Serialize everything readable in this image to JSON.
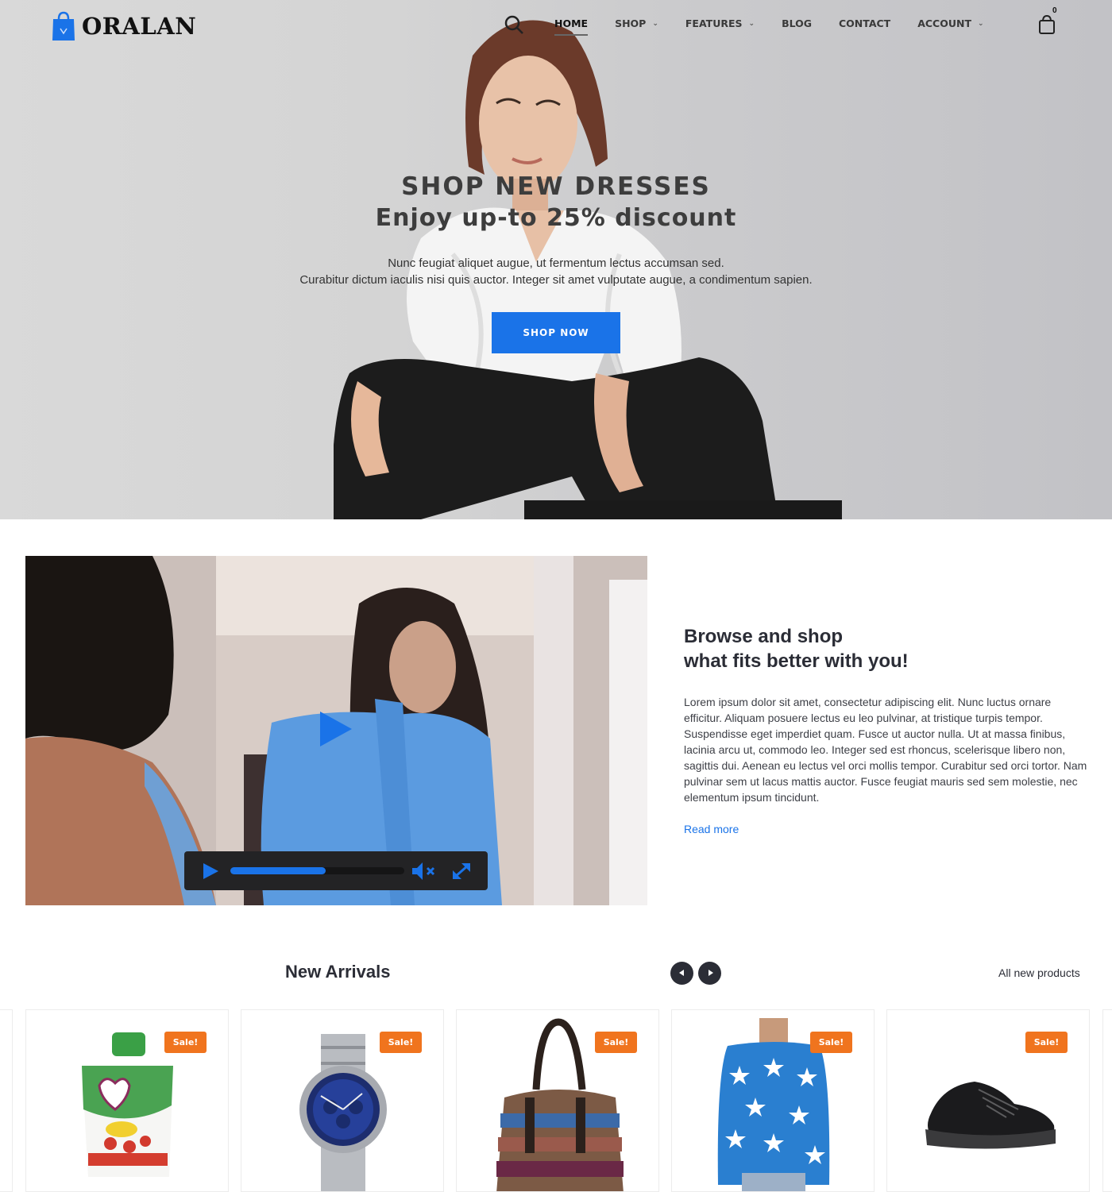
{
  "header": {
    "logo_text": "ORALAN",
    "nav": [
      {
        "label": "HOME",
        "active": true,
        "has_dropdown": false
      },
      {
        "label": "SHOP",
        "active": false,
        "has_dropdown": true
      },
      {
        "label": "FEATURES",
        "active": false,
        "has_dropdown": true
      },
      {
        "label": "BLOG",
        "active": false,
        "has_dropdown": false
      },
      {
        "label": "CONTACT",
        "active": false,
        "has_dropdown": false
      },
      {
        "label": "ACCOUNT",
        "active": false,
        "has_dropdown": true
      }
    ],
    "icons": {
      "search": "search-icon",
      "cart": "shopping-bag-icon"
    },
    "cart_count": "0"
  },
  "hero": {
    "title": "SHOP NEW DRESSES",
    "subtitle": "Enjoy up-to 25% discount",
    "description_line1": "Nunc feugiat aliquet augue, ut fermentum lectus accumsan sed.",
    "description_line2": "Curabitur dictum iaculis nisi quis auctor. Integer sit amet vulputate augue, a condimentum sapien.",
    "cta_label": "SHOP NOW"
  },
  "video": {
    "progress_fraction": 0.55,
    "muted": true,
    "icons": {
      "play": "play-icon",
      "mute": "volume-mute-icon",
      "fullscreen": "fullscreen-icon"
    }
  },
  "about": {
    "title_line1": "Browse and shop",
    "title_line2": "what fits better with you!",
    "text": "Lorem ipsum dolor sit amet, consectetur adipiscing elit. Nunc luctus ornare efficitur. Aliquam posuere lectus eu leo pulvinar, at tristique turpis tempor. Suspendisse eget imperdiet quam. Fusce ut auctor nulla. Ut at massa finibus, lacinia arcu ut, commodo leo. Integer sed est rhoncus, scelerisque libero non, sagittis dui. Aenean eu lectus vel orci mollis tempor. Curabitur sed orci tortor. Nam pulvinar sem ut lacus mattis auctor. Fusce feugiat mauris sed sem molestie, nec elementum ipsum tincidunt.",
    "read_more": "Read more"
  },
  "arrivals": {
    "title": "New Arrivals",
    "all_link": "All new products",
    "products": [
      {
        "image": "baby-food-pouch",
        "badge": "Sale!"
      },
      {
        "image": "wristwatch",
        "badge": "Sale!"
      },
      {
        "image": "striped-handbag",
        "badge": "Sale!"
      },
      {
        "image": "star-sweater",
        "badge": "Sale!"
      },
      {
        "image": "black-sneaker",
        "badge": "Sale!"
      }
    ]
  },
  "colors": {
    "accent": "#1a73e8",
    "sale_badge": "#f0741e",
    "dark_text": "#2b2d36",
    "video_controls_bg": "#232325"
  }
}
